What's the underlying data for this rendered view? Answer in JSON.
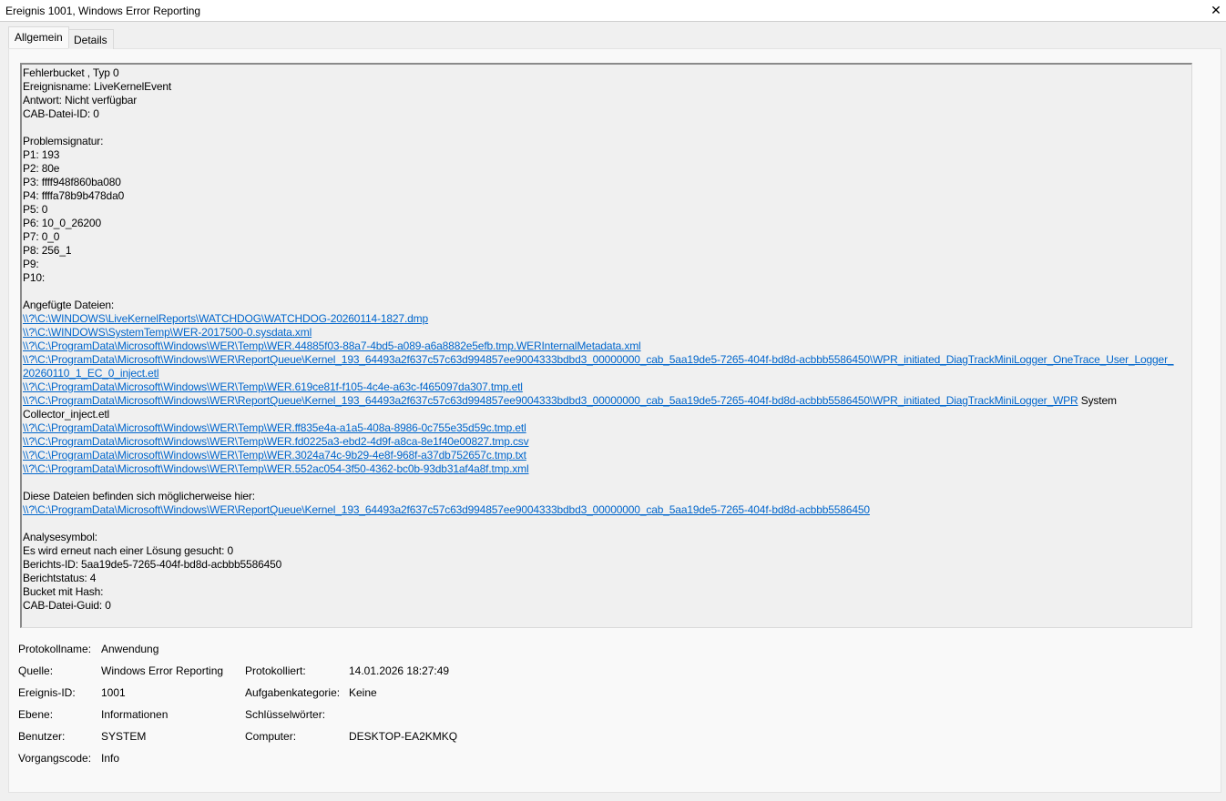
{
  "window": {
    "title": "Ereignis 1001, Windows Error Reporting",
    "close_glyph": "✕"
  },
  "tabs": [
    {
      "label": "Allgemein",
      "active": true
    },
    {
      "label": "Details",
      "active": false
    }
  ],
  "details_text": {
    "head": [
      "Fehlerbucket , Typ 0",
      "Ereignisname: LiveKernelEvent",
      "Antwort: Nicht verfügbar",
      "CAB-Datei-ID: 0"
    ],
    "signature_title": "Problemsignatur:",
    "signature": [
      "P1: 193",
      "P2: 80e",
      "P3: ffff948f860ba080",
      "P4: ffffa78b9b478da0",
      "P5: 0",
      "P6: 10_0_26200",
      "P7: 0_0",
      "P8: 256_1",
      "P9:",
      "P10:"
    ],
    "attached_title": "Angefügte Dateien:",
    "attached": [
      "\\\\?\\C:\\WINDOWS\\LiveKernelReports\\WATCHDOG\\WATCHDOG-20260114-1827.dmp",
      "\\\\?\\C:\\WINDOWS\\SystemTemp\\WER-2017500-0.sysdata.xml",
      "\\\\?\\C:\\ProgramData\\Microsoft\\Windows\\WER\\Temp\\WER.44885f03-88a7-4bd5-a089-a6a8882e5efb.tmp.WERInternalMetadata.xml",
      "\\\\?\\C:\\ProgramData\\Microsoft\\Windows\\WER\\ReportQueue\\Kernel_193_64493a2f637c57c63d994857ee9004333bdbd3_00000000_cab_5aa19de5-7265-404f-bd8d-acbbb5586450\\WPR_initiated_DiagTrackMiniLogger_OneTrace_User_Logger_",
      "20260110_1_EC_0_inject.etl",
      "\\\\?\\C:\\ProgramData\\Microsoft\\Windows\\WER\\Temp\\WER.619ce81f-f105-4c4e-a63c-f465097da307.tmp.etl",
      "\\\\?\\C:\\ProgramData\\Microsoft\\Windows\\WER\\ReportQueue\\Kernel_193_64493a2f637c57c63d994857ee9004333bdbd3_00000000_cab_5aa19de5-7265-404f-bd8d-acbbb5586450\\WPR_initiated_DiagTrackMiniLogger_WPR",
      "Collector_inject.etl",
      "\\\\?\\C:\\ProgramData\\Microsoft\\Windows\\WER\\Temp\\WER.ff835e4a-a1a5-408a-8986-0c755e35d59c.tmp.etl",
      "\\\\?\\C:\\ProgramData\\Microsoft\\Windows\\WER\\Temp\\WER.fd0225a3-ebd2-4d9f-a8ca-8e1f40e00827.tmp.csv",
      "\\\\?\\C:\\ProgramData\\Microsoft\\Windows\\WER\\Temp\\WER.3024a74c-9b29-4e8f-968f-a37db752657c.tmp.txt",
      "\\\\?\\C:\\ProgramData\\Microsoft\\Windows\\WER\\Temp\\WER.552ac054-3f50-4362-bc0b-93db31af4a8f.tmp.xml"
    ],
    "system_suffix": " System",
    "location_title": "Diese Dateien befinden sich möglicherweise hier:",
    "location": "\\\\?\\C:\\ProgramData\\Microsoft\\Windows\\WER\\ReportQueue\\Kernel_193_64493a2f637c57c63d994857ee9004333bdbd3_00000000_cab_5aa19de5-7265-404f-bd8d-acbbb5586450",
    "tail": [
      "Analysesymbol:",
      "Es wird erneut nach einer Lösung gesucht: 0",
      "Berichts-ID: 5aa19de5-7265-404f-bd8d-acbbb5586450",
      "Berichtstatus: 4",
      "Bucket mit Hash:",
      "CAB-Datei-Guid: 0"
    ]
  },
  "properties": {
    "log_name_label": "Protokollname:",
    "log_name": "Anwendung",
    "source_label": "Quelle:",
    "source": "Windows Error Reporting",
    "logged_label": "Protokolliert:",
    "logged": "14.01.2026 18:27:49",
    "event_id_label": "Ereignis-ID:",
    "event_id": "1001",
    "task_category_label": "Aufgabenkategorie:",
    "task_category": "Keine",
    "level_label": "Ebene:",
    "level": "Informationen",
    "keywords_label": "Schlüsselwörter:",
    "keywords": "",
    "user_label": "Benutzer:",
    "user": "SYSTEM",
    "computer_label": "Computer:",
    "computer": "DESKTOP-EA2KMKQ",
    "opcode_label": "Vorgangscode:",
    "opcode": "Info"
  }
}
